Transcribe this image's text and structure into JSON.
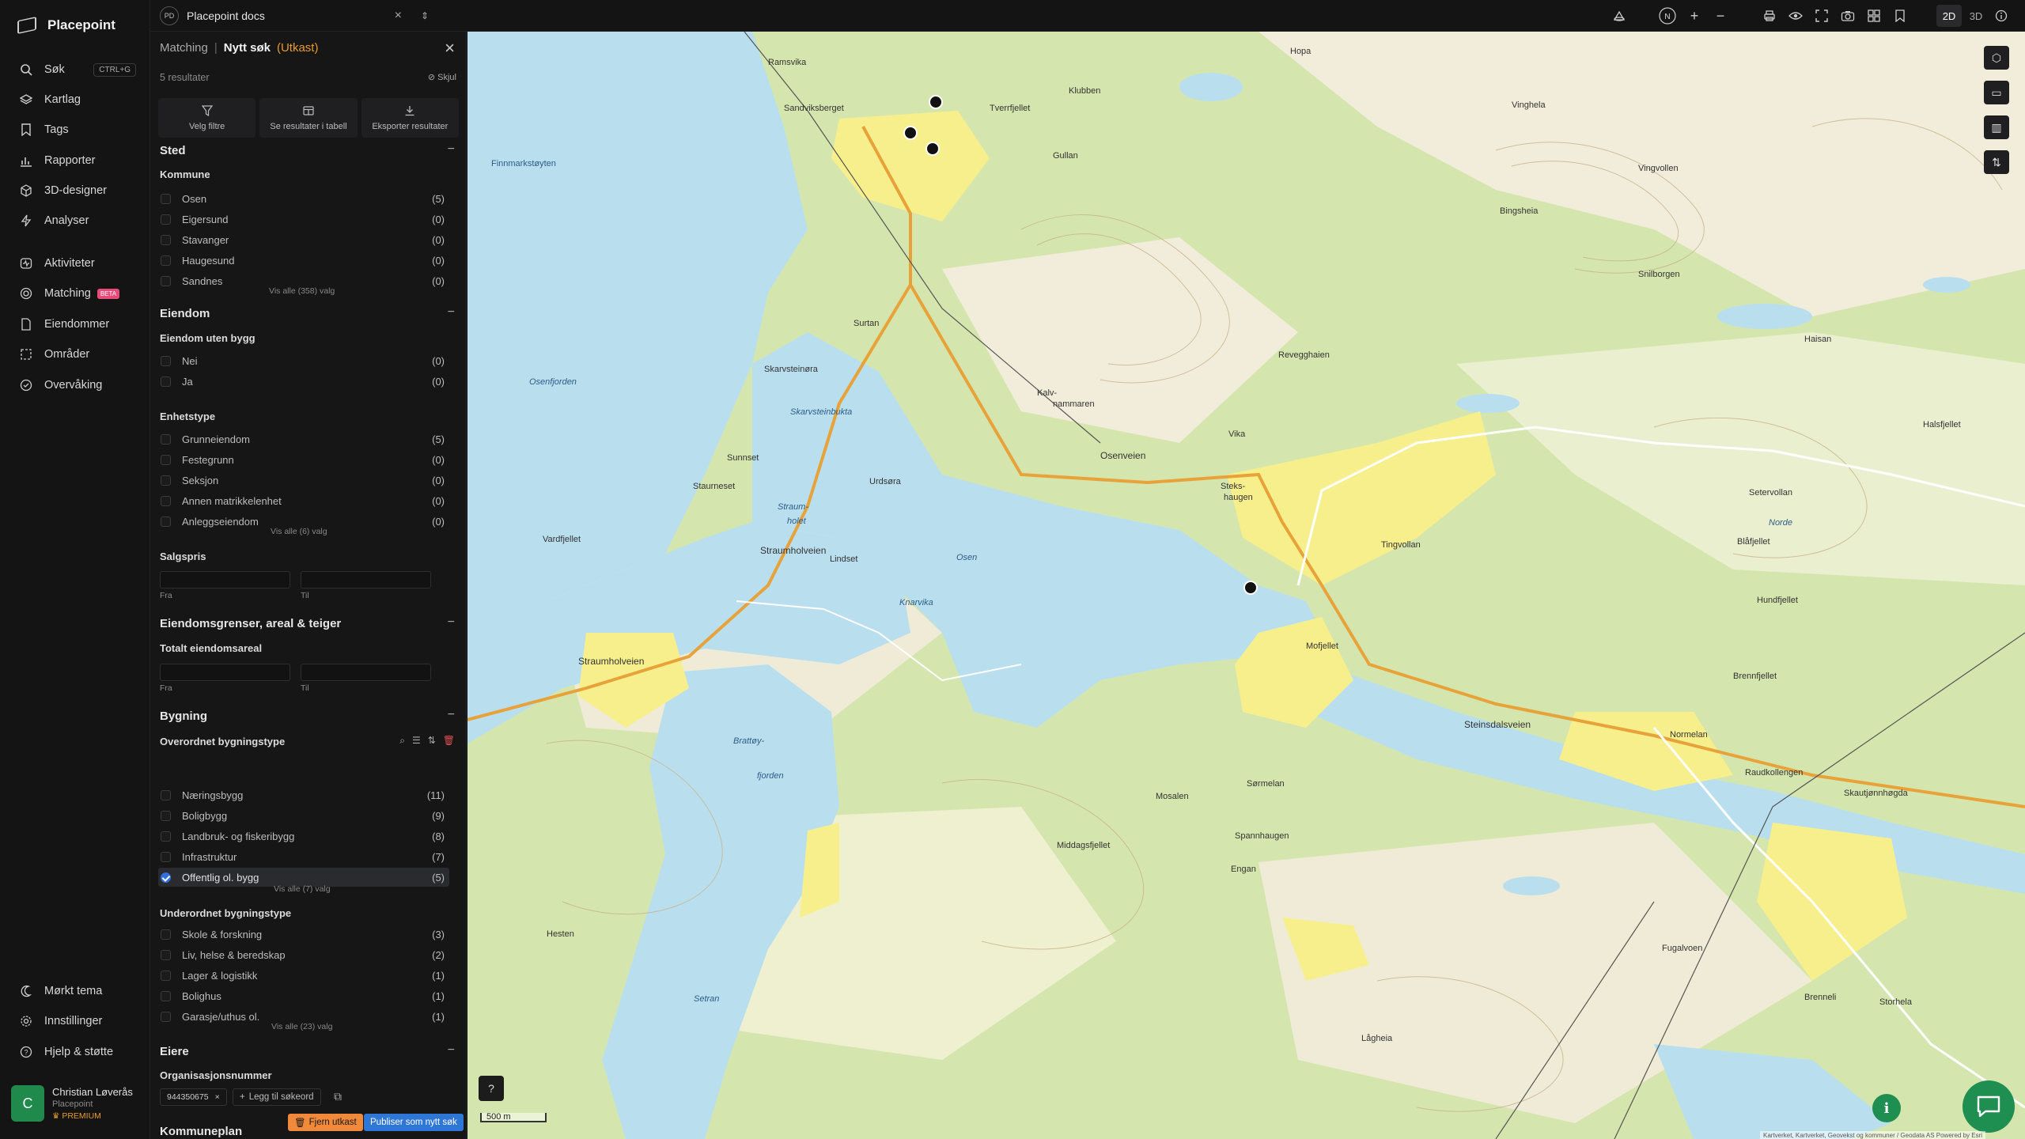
{
  "app": {
    "brand": "Placepoint",
    "workspace_badge": "PD",
    "workspace_name": "Placepoint docs"
  },
  "nav": {
    "items": [
      {
        "label": "Søk",
        "icon": "search-icon",
        "shortcut": "CTRL+G"
      },
      {
        "label": "Kartlag",
        "icon": "layers-icon"
      },
      {
        "label": "Tags",
        "icon": "bookmark-icon"
      },
      {
        "label": "Rapporter",
        "icon": "bar-chart-icon"
      },
      {
        "label": "3D-designer",
        "icon": "cube-icon"
      },
      {
        "label": "Analyser",
        "icon": "bolt-icon"
      },
      {
        "label": "Aktiviteter",
        "icon": "activity-icon"
      },
      {
        "label": "Matching",
        "icon": "target-icon",
        "badge": "BETA"
      },
      {
        "label": "Eiendommer",
        "icon": "document-icon"
      },
      {
        "label": "Områder",
        "icon": "area-icon"
      },
      {
        "label": "Overvåking",
        "icon": "monitor-icon"
      }
    ],
    "bottom_items": [
      {
        "label": "Mørkt tema",
        "icon": "moon-icon"
      },
      {
        "label": "Innstillinger",
        "icon": "gear-icon"
      },
      {
        "label": "Hjelp & støtte",
        "icon": "help-icon"
      }
    ],
    "user": {
      "initial": "C",
      "name": "Christian Løverås",
      "org": "Placepoint",
      "plan": "PREMIUM"
    }
  },
  "topbar": {
    "toggle_2d": "2D",
    "toggle_3d": "3D",
    "active_mode": "2D"
  },
  "panel": {
    "breadcrumb": {
      "parent": "Matching",
      "separator": "|",
      "current": "Nytt søk",
      "status": "(Utkast)"
    },
    "results_count": "5 resultater",
    "hide_label": "Skjul",
    "actions": [
      {
        "label": "Velg filtre",
        "icon": "filter-icon"
      },
      {
        "label": "Se resultater i tabell",
        "icon": "table-icon"
      },
      {
        "label": "Eksporter resultater",
        "icon": "download-icon"
      }
    ],
    "sections": {
      "sted": {
        "title": "Sted",
        "group": "Kommune",
        "items": [
          {
            "label": "Osen",
            "count": "(5)"
          },
          {
            "label": "Eigersund",
            "count": "(0)"
          },
          {
            "label": "Stavanger",
            "count": "(0)"
          },
          {
            "label": "Haugesund",
            "count": "(0)"
          },
          {
            "label": "Sandnes",
            "count": "(0)"
          }
        ],
        "show_all": "Vis alle (358) valg"
      },
      "eiendom": {
        "title": "Eiendom",
        "group1": "Eiendom uten bygg",
        "items1": [
          {
            "label": "Nei",
            "count": "(0)"
          },
          {
            "label": "Ja",
            "count": "(0)"
          }
        ],
        "group2": "Enhetstype",
        "items2": [
          {
            "label": "Grunneiendom",
            "count": "(5)"
          },
          {
            "label": "Festegrunn",
            "count": "(0)"
          },
          {
            "label": "Seksjon",
            "count": "(0)"
          },
          {
            "label": "Annen matrikkelenhet",
            "count": "(0)"
          },
          {
            "label": "Anleggseiendom",
            "count": "(0)"
          }
        ],
        "show_all": "Vis alle (6) valg",
        "group3": "Salgspris",
        "from": "Fra",
        "to": "Til"
      },
      "grenser": {
        "title": "Eiendomsgrenser, areal & teiger",
        "group": "Totalt eiendomsareal",
        "from": "Fra",
        "to": "Til"
      },
      "bygning": {
        "title": "Bygning",
        "group1": "Overordnet bygningstype",
        "items1": [
          {
            "label": "Næringsbygg",
            "count": "(11)",
            "checked": false
          },
          {
            "label": "Boligbygg",
            "count": "(9)",
            "checked": false
          },
          {
            "label": "Landbruk- og fiskeribygg",
            "count": "(8)",
            "checked": false
          },
          {
            "label": "Infrastruktur",
            "count": "(7)",
            "checked": false
          },
          {
            "label": "Offentlig ol. bygg",
            "count": "(5)",
            "checked": true
          }
        ],
        "show_all1": "Vis alle (7) valg",
        "group2": "Underordnet bygningstype",
        "items2": [
          {
            "label": "Skole & forskning",
            "count": "(3)"
          },
          {
            "label": "Liv, helse & beredskap",
            "count": "(2)"
          },
          {
            "label": "Lager & logistikk",
            "count": "(1)"
          },
          {
            "label": "Bolighus",
            "count": "(1)"
          },
          {
            "label": "Garasje/uthus ol.",
            "count": "(1)"
          }
        ],
        "show_all2": "Vis alle (23) valg"
      },
      "eiere": {
        "title": "Eiere",
        "group": "Organisasjonsnummer",
        "chip": "944350675",
        "add_keyword": "Legg til søkeord"
      },
      "kommuneplan": {
        "title": "Kommuneplan"
      }
    },
    "footer": {
      "remove_draft": "Fjern utkast",
      "publish": "Publiser som nytt søk"
    }
  },
  "map": {
    "scale_label": "500 m",
    "attribution": "Kartverket, Kartverket, Geovekst og kommuner / Geodata AS Powered by Esri",
    "labels": [
      "Ramsvika",
      "Hopa",
      "Tverrfjellet",
      "Klubben",
      "Vinghela",
      "Sandviksberget",
      "Finnmarkstøyten",
      "Osenfjorden",
      "Skarvsteinøra",
      "Skarvsteinbukta",
      "Osenveien",
      "Staurneset",
      "Straum-",
      "holet",
      "Straumholveien",
      "Straumholveien",
      "Vardfjellet",
      "Osen",
      "Knarvika",
      "Lindset",
      "Tingvollan",
      "Revegghaien",
      "Bingsheia",
      "Steinsdalsveien",
      "Brattøy-",
      "fjorden",
      "Middagsfjellet",
      "Mosalen",
      "Engan",
      "Sørmelan",
      "Spannhaugen",
      "Hesten",
      "Setran",
      "Haisan",
      "Halsfjellet",
      "Setervollan",
      "Norde",
      "Blåfjellet",
      "Hundfjellet",
      "Brennfjellet",
      "Normelan",
      "Raudkollengen",
      "Fugalvoen",
      "Skautjønnhøgda",
      "Storhela",
      "Brenneli",
      "Lågheia",
      "Vika",
      "Steks-",
      "haugen",
      "Mofjellet",
      "Sunnset",
      "Urdsøra",
      "Kalv-",
      "nammaren",
      "Surtan",
      "Gullan",
      "Vingvollen",
      "Snilborgen"
    ],
    "marker_count": 4,
    "accent": "#1e8f50"
  },
  "colors": {
    "accent_orange": "#e89b2c",
    "publish_blue": "#2f77d6",
    "remove_orange": "#f08a3a",
    "checkbox_blue": "#2f6fe0",
    "water": "#b9dfef",
    "forest": "#cfe4a8",
    "farmland": "#f7ef8c",
    "land": "#efe9d4"
  }
}
